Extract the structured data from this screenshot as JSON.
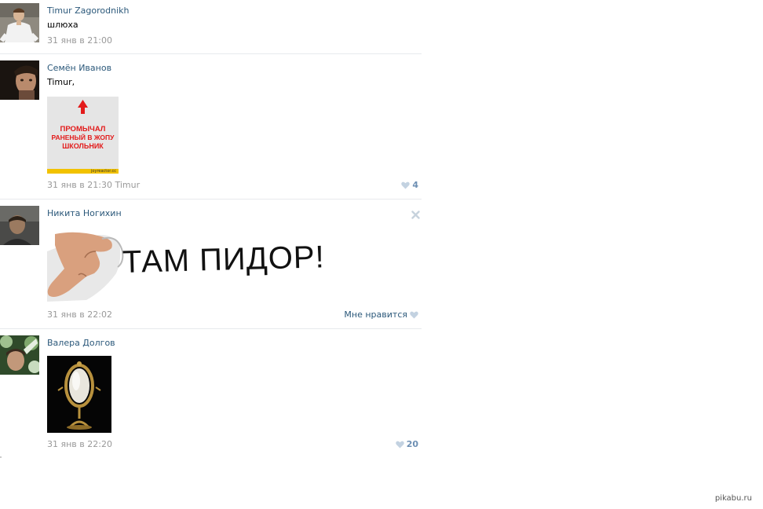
{
  "comments": [
    {
      "author": "Timur Zagorodnikh",
      "text": "шлюха",
      "date": "31 янв в 21:00"
    },
    {
      "author": "Семён Иванов",
      "text": "Timur,",
      "date": "31 янв в 21:30",
      "reply_to": "Timur",
      "attachment": {
        "lines": [
          "ПРОМЫЧАЛ",
          "РАНЕНЫЙ В ЖОПУ",
          "ШКОЛЬНИК"
        ],
        "source": "joyreactor.cc"
      },
      "likes": "4"
    },
    {
      "author": "Никита Ногихин",
      "date": "31 янв в 22:02",
      "attachment": {
        "caption": "ТАМ ПИДОР!"
      },
      "like_label": "Мне нравится"
    },
    {
      "author": "Валера Долгов",
      "date": "31 янв в 22:20",
      "likes": "20"
    }
  ],
  "watermark": "pikabu.ru",
  "colors": {
    "link": "#2b587a",
    "meta": "#999999",
    "like_count": "#6d8fb3",
    "divider": "#e7eaed"
  }
}
